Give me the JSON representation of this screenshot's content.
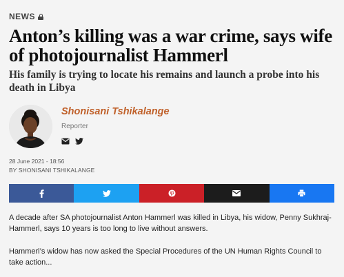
{
  "section": {
    "label": "NEWS",
    "lock_icon": "lock-icon"
  },
  "article": {
    "headline": "Anton’s killing was a war crime, says wife of photojournalist Hammerl",
    "subheadline": "His family is trying to locate his remains and launch a probe into his death in Libya"
  },
  "author": {
    "name": "Shonisani Tshikalange",
    "role": "Reporter",
    "social_icons": [
      "email-icon",
      "twitter-icon"
    ]
  },
  "meta": {
    "date": "28 June 2021 - 18:56",
    "byline": "BY SHONISANI TSHIKALANGE"
  },
  "share": [
    {
      "name": "facebook",
      "icon": "facebook-icon",
      "color": "#3b5998"
    },
    {
      "name": "twitter",
      "icon": "twitter-icon",
      "color": "#1da1f2"
    },
    {
      "name": "pinterest",
      "icon": "pinterest-icon",
      "color": "#cb2027"
    },
    {
      "name": "email",
      "icon": "email-icon",
      "color": "#1c1c1c"
    },
    {
      "name": "print",
      "icon": "print-icon",
      "color": "#1877f2"
    }
  ],
  "body": {
    "paragraph_1": "A decade after SA photojournalist Anton Hammerl was killed in Libya, his widow, Penny Sukhraj-Hammerl, says 10 years is too long to live without answers.",
    "paragraph_2": "Hammerl’s widow has now asked the Special Procedures of the UN Human Rights Council to take action..."
  },
  "colors": {
    "accent": "#c0612b"
  }
}
